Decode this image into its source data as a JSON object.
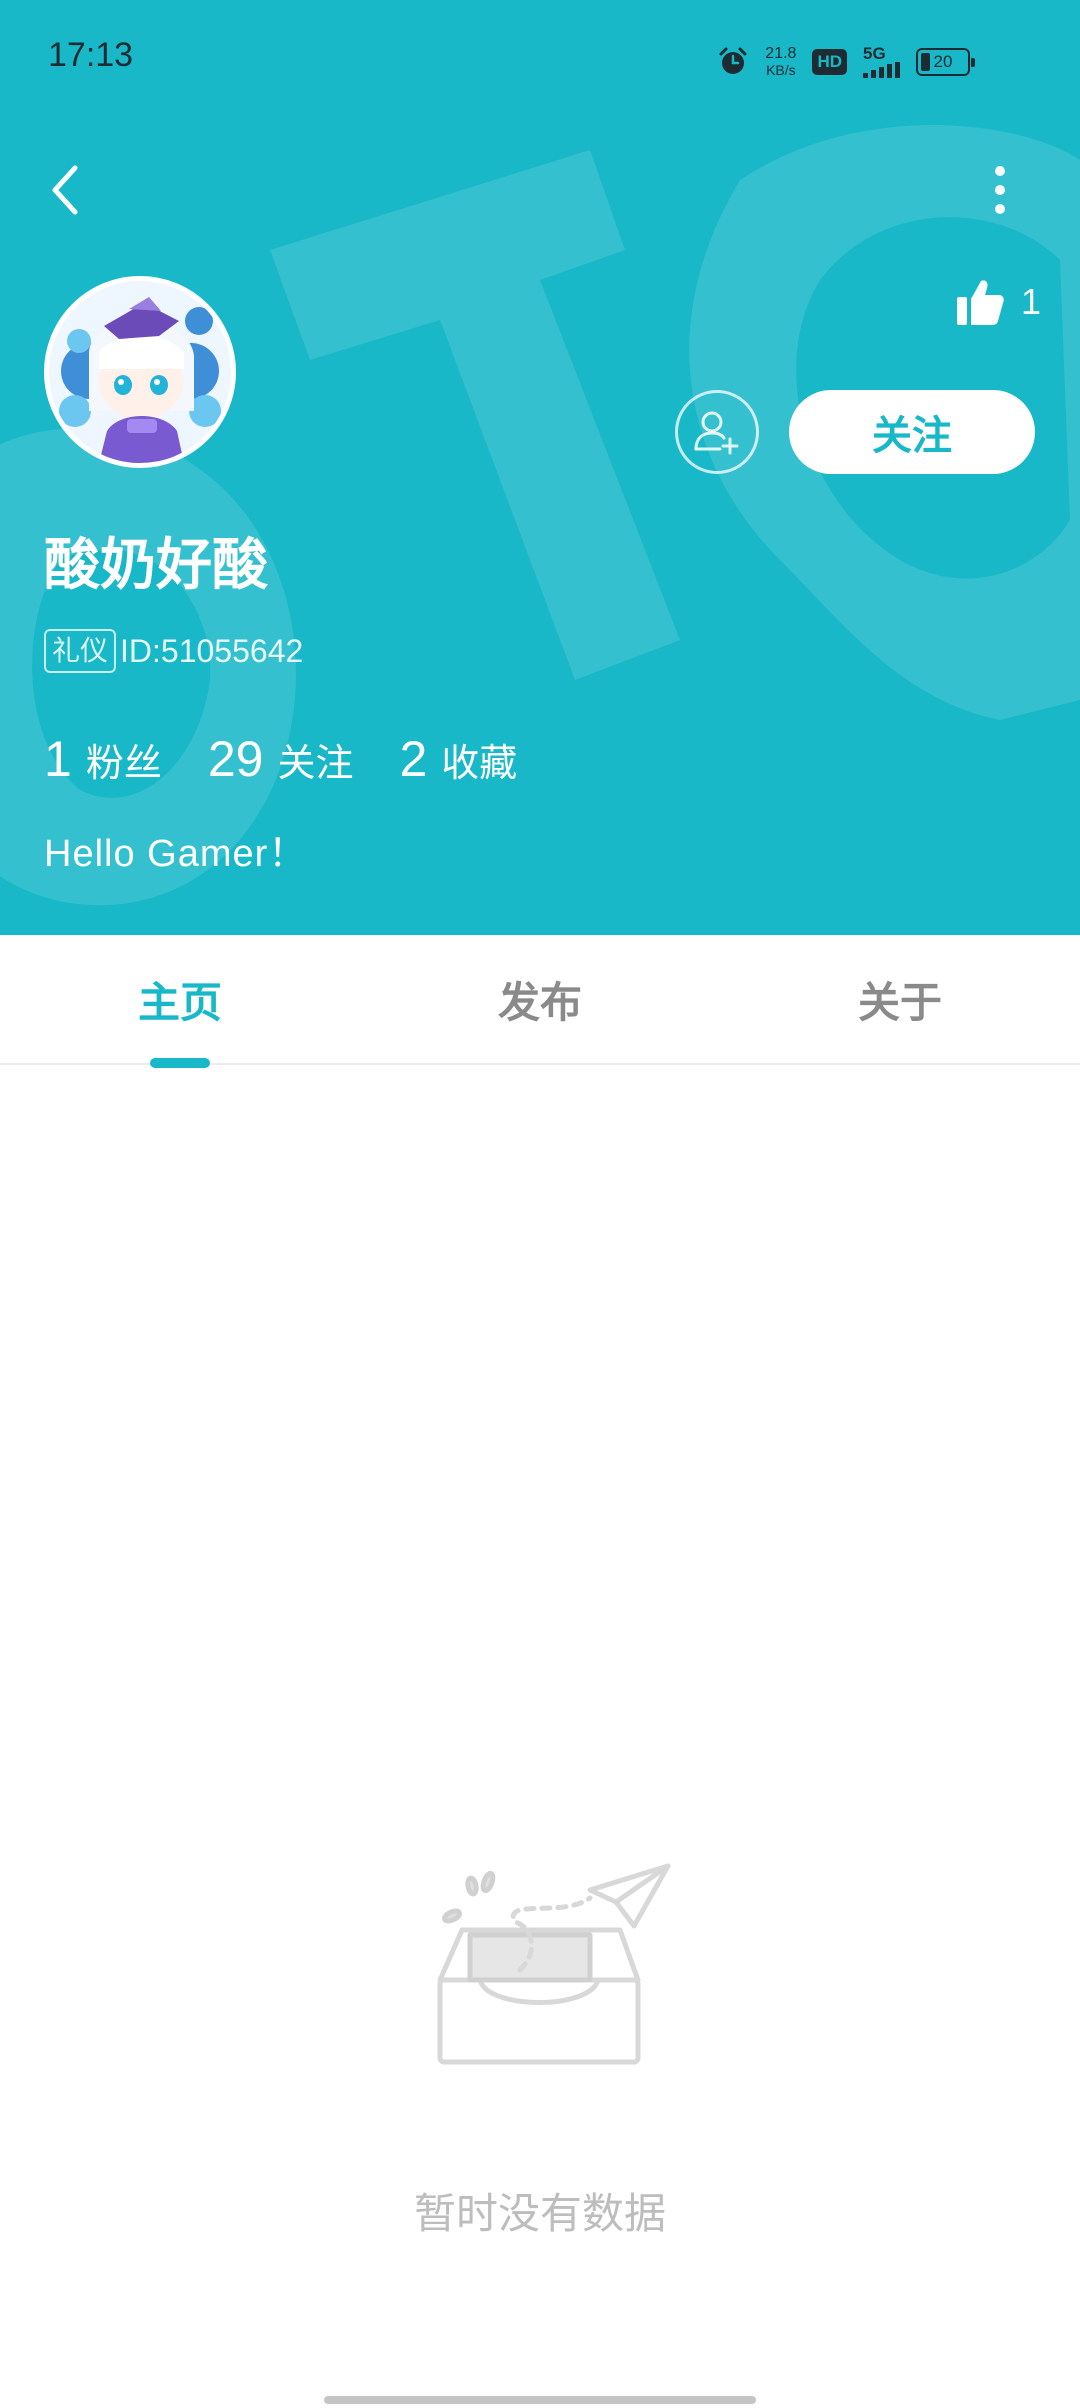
{
  "status_bar": {
    "time": "17:13",
    "net_speed_value": "21.8",
    "net_speed_unit": "KB/s",
    "hd_label": "HD",
    "network_label": "5G",
    "battery_level": "20",
    "icons": [
      "alarm-icon",
      "signal-icon",
      "battery-icon"
    ]
  },
  "header": {
    "background_color": "#18b8c8",
    "accent_color": "#18b8c8",
    "back_icon": "chevron-left-icon",
    "more_icon": "vertical-dots-icon",
    "like_icon": "thumbs-up-icon",
    "like_count": "1"
  },
  "profile": {
    "username": "酸奶好酸",
    "badge": "礼仪",
    "id_text": "ID:51055642",
    "follow_label": "关注",
    "add_friend_icon": "add-user-icon",
    "stats": [
      {
        "value": "1",
        "label": "粉丝"
      },
      {
        "value": "29",
        "label": "关注"
      },
      {
        "value": "2",
        "label": "收藏"
      }
    ],
    "bio": "Hello Gamer！"
  },
  "tabs": [
    {
      "label": "主页",
      "active": true
    },
    {
      "label": "发布",
      "active": false
    },
    {
      "label": "关于",
      "active": false
    }
  ],
  "empty_state": {
    "icon": "empty-inbox-icon",
    "message": "暂时没有数据"
  }
}
